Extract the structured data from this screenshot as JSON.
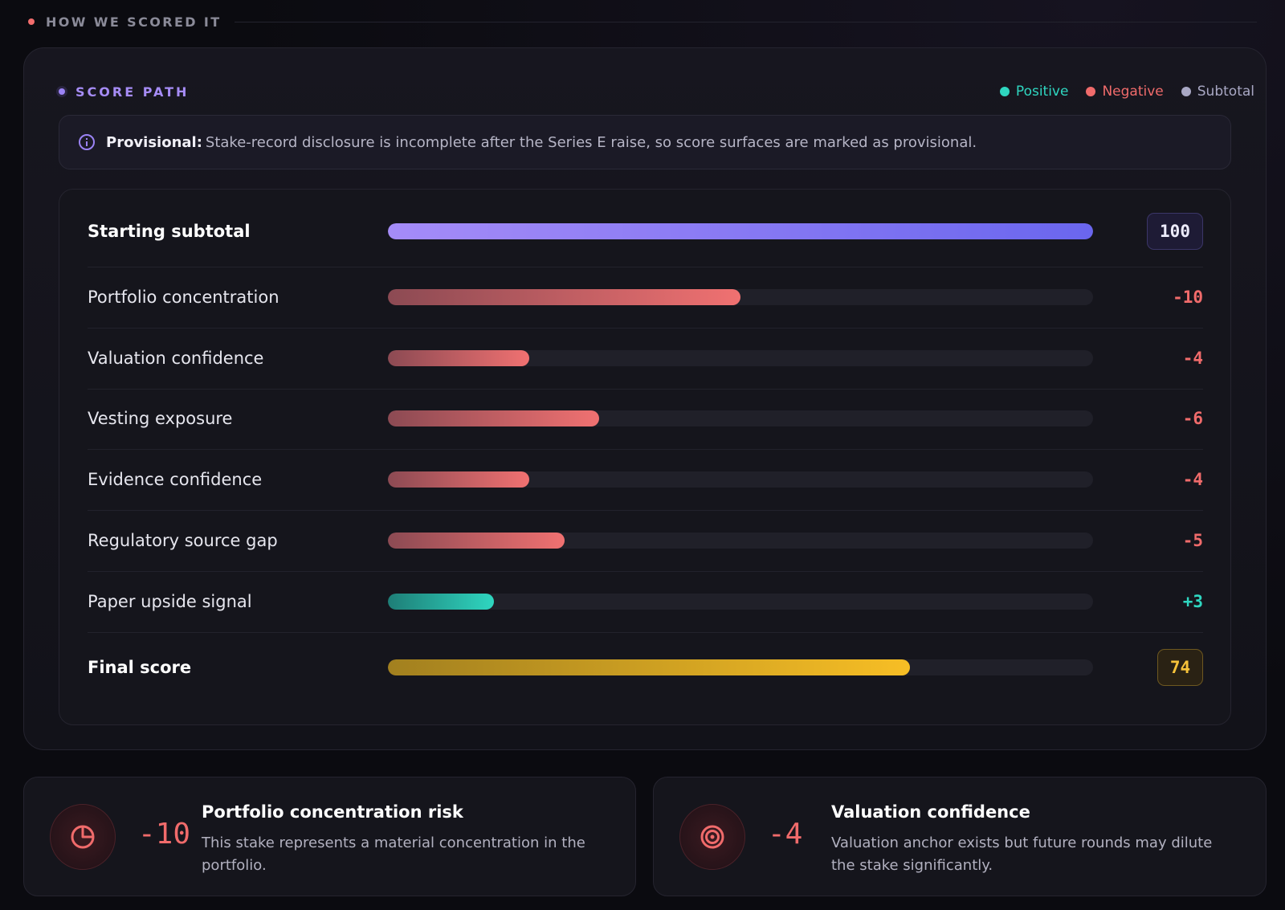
{
  "section": {
    "title": "HOW WE SCORED IT"
  },
  "card": {
    "title": "SCORE PATH",
    "legend": [
      {
        "label": "Positive",
        "color": "#2fd6c0"
      },
      {
        "label": "Negative",
        "color": "#f06b6b"
      },
      {
        "label": "Subtotal",
        "color": "#a9a8c4"
      }
    ]
  },
  "notice": {
    "strong": "Provisional:",
    "text": "Stake-record disclosure is incomplete after the Series E raise, so score surfaces are marked as provisional."
  },
  "rows": [
    {
      "label": "Starting subtotal",
      "value": "100",
      "kind": "subtotal",
      "fraction": 1.0
    },
    {
      "label": "Portfolio concentration",
      "value": "-10",
      "kind": "neg",
      "fraction": 0.5
    },
    {
      "label": "Valuation confidence",
      "value": "-4",
      "kind": "neg",
      "fraction": 0.2
    },
    {
      "label": "Vesting exposure",
      "value": "-6",
      "kind": "neg",
      "fraction": 0.3
    },
    {
      "label": "Evidence confidence",
      "value": "-4",
      "kind": "neg",
      "fraction": 0.2
    },
    {
      "label": "Regulatory source gap",
      "value": "-5",
      "kind": "neg",
      "fraction": 0.25
    },
    {
      "label": "Paper upside signal",
      "value": "+3",
      "kind": "pos",
      "fraction": 0.15
    },
    {
      "label": "Final score",
      "value": "74",
      "kind": "final",
      "fraction": 0.74
    }
  ],
  "bottom_cards": [
    {
      "icon": "pie-chart-icon",
      "value": "-10",
      "title": "Portfolio concentration risk",
      "desc": "This stake represents a material concentration in the portfolio."
    },
    {
      "icon": "target-icon",
      "value": "-4",
      "title": "Valuation confidence",
      "desc": "Valuation anchor exists but future rounds may dilute the stake significantly."
    }
  ]
}
